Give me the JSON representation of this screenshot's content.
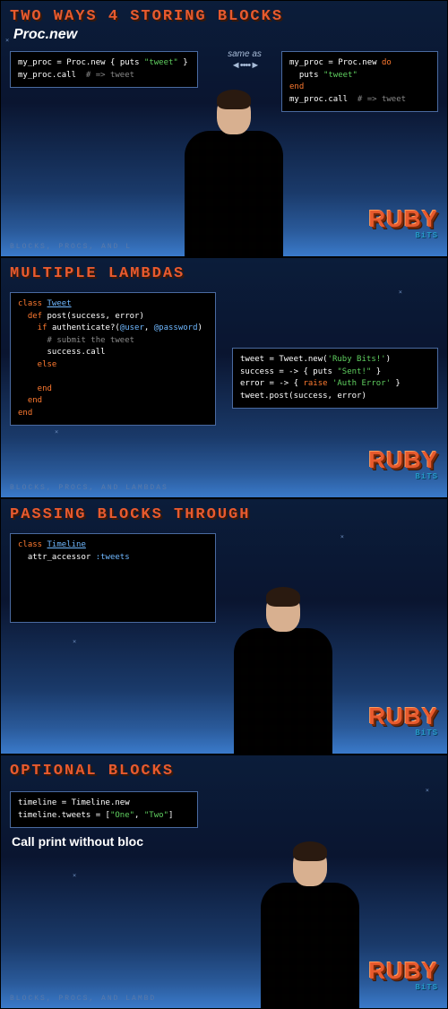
{
  "logo": {
    "main": "RUBY",
    "sub": "BiTS"
  },
  "slides": {
    "s1": {
      "title": "TWO WAYS 4 STORING BLOCKS",
      "subtitle": "Proc.new",
      "sameas": "same as",
      "arrows": "◄ • • • • ►",
      "code_left": [
        {
          "t": "wht",
          "v": "my_proc = "
        },
        {
          "t": "wht",
          "v": "Proc"
        },
        {
          "t": "wht",
          "v": ".new { "
        },
        {
          "t": "wht",
          "v": "puts "
        },
        {
          "t": "str",
          "v": "\"tweet\""
        },
        {
          "t": "wht",
          "v": " }"
        },
        {
          "t": "br"
        },
        {
          "t": "wht",
          "v": "my_proc.call  "
        },
        {
          "t": "cmt",
          "v": "# => tweet"
        }
      ],
      "code_right": [
        {
          "t": "wht",
          "v": "my_proc = "
        },
        {
          "t": "wht",
          "v": "Proc"
        },
        {
          "t": "wht",
          "v": ".new "
        },
        {
          "t": "kw",
          "v": "do"
        },
        {
          "t": "br"
        },
        {
          "t": "wht",
          "v": "  puts "
        },
        {
          "t": "str",
          "v": "\"tweet\""
        },
        {
          "t": "br"
        },
        {
          "t": "kw",
          "v": "end"
        },
        {
          "t": "br"
        },
        {
          "t": "wht",
          "v": "my_proc.call  "
        },
        {
          "t": "cmt",
          "v": "# => tweet"
        }
      ],
      "footer": "BLOCKS, PROCS, AND L"
    },
    "s2": {
      "title": "MULTIPLE LAMBDAS",
      "code_left": [
        {
          "t": "kw",
          "v": "class "
        },
        {
          "t": "cls",
          "v": "Tweet"
        },
        {
          "t": "br"
        },
        {
          "t": "kw",
          "v": "  def "
        },
        {
          "t": "wht",
          "v": "post("
        },
        {
          "t": "wht",
          "v": "success, error"
        },
        {
          "t": "wht",
          "v": ")"
        },
        {
          "t": "br"
        },
        {
          "t": "kw",
          "v": "    if "
        },
        {
          "t": "wht",
          "v": "authenticate?("
        },
        {
          "t": "var",
          "v": "@user"
        },
        {
          "t": "wht",
          "v": ", "
        },
        {
          "t": "var",
          "v": "@password"
        },
        {
          "t": "wht",
          "v": ")"
        },
        {
          "t": "br"
        },
        {
          "t": "cmt",
          "v": "      # submit the tweet"
        },
        {
          "t": "br"
        },
        {
          "t": "wht",
          "v": "      success.call"
        },
        {
          "t": "br"
        },
        {
          "t": "kw",
          "v": "    else"
        },
        {
          "t": "br"
        },
        {
          "t": "wht",
          "v": ""
        },
        {
          "t": "br"
        },
        {
          "t": "kw",
          "v": "    end"
        },
        {
          "t": "br"
        },
        {
          "t": "kw",
          "v": "  end"
        },
        {
          "t": "br"
        },
        {
          "t": "kw",
          "v": "end"
        }
      ],
      "code_right": [
        {
          "t": "wht",
          "v": "tweet = Tweet.new("
        },
        {
          "t": "str",
          "v": "'Ruby Bits!'"
        },
        {
          "t": "wht",
          "v": ")"
        },
        {
          "t": "br"
        },
        {
          "t": "wht",
          "v": "success = -> { puts "
        },
        {
          "t": "str",
          "v": "\"Sent!\""
        },
        {
          "t": "wht",
          "v": " }"
        },
        {
          "t": "br"
        },
        {
          "t": "wht",
          "v": "error = -> { "
        },
        {
          "t": "kw",
          "v": "raise "
        },
        {
          "t": "str",
          "v": "'Auth Error'"
        },
        {
          "t": "wht",
          "v": " }"
        },
        {
          "t": "br"
        },
        {
          "t": "wht",
          "v": "tweet.post(success, error)"
        }
      ],
      "footer": "BLOCKS, PROCS, AND LAMBDAS"
    },
    "s3": {
      "title": "PASSING BLOCKS THROUGH",
      "code": [
        {
          "t": "kw",
          "v": "class "
        },
        {
          "t": "cls",
          "v": "Timeline"
        },
        {
          "t": "br"
        },
        {
          "t": "wht",
          "v": "  attr_accessor "
        },
        {
          "t": "sym",
          "v": ":tweets"
        }
      ],
      "footer": ""
    },
    "s4": {
      "title": "OPTIONAL BLOCKS",
      "code": [
        {
          "t": "wht",
          "v": "timeline = Timeline.new"
        },
        {
          "t": "br"
        },
        {
          "t": "wht",
          "v": "timeline.tweets = ["
        },
        {
          "t": "str",
          "v": "\"One\""
        },
        {
          "t": "wht",
          "v": ", "
        },
        {
          "t": "str",
          "v": "\"Two\""
        },
        {
          "t": "wht",
          "v": "]"
        }
      ],
      "caption": "Call print without bloc",
      "footer": "BLOCKS, PROCS, AND LAMBD"
    }
  }
}
